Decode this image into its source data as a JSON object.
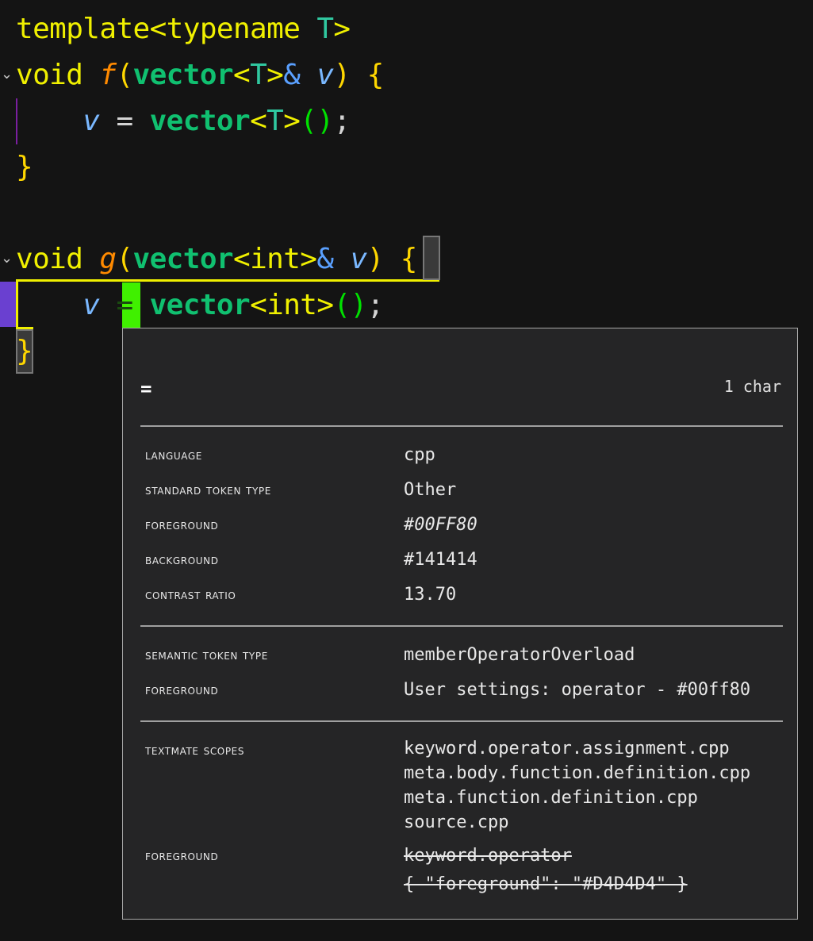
{
  "code": {
    "line1": {
      "template": "template",
      "lt": "<",
      "typename": "typename",
      "T": "T",
      "gt": ">"
    },
    "line2": {
      "void": "void",
      "fname": "f",
      "open": "(",
      "vector": "vector",
      "lt": "<",
      "T": "T",
      "gt": ">",
      "amp": "&",
      "param": "v",
      "close": ")",
      "brace": "{"
    },
    "line3": {
      "v": "v",
      "eq": "=",
      "vector": "vector",
      "lt": "<",
      "T": "T",
      "gt": ">",
      "parens": "()",
      "semi": ";"
    },
    "line4": {
      "brace": "}"
    },
    "line6": {
      "void": "void",
      "fname": "g",
      "open": "(",
      "vector": "vector",
      "lt": "<",
      "int": "int",
      "gt": ">",
      "amp": "&",
      "param": "v",
      "close": ")",
      "brace": "{"
    },
    "line7": {
      "v": "v",
      "eq": "=",
      "vector": "vector",
      "lt": "<",
      "int": "int",
      "gt": ">",
      "parens": "()",
      "semi": ";"
    },
    "line8": {
      "brace": "}"
    }
  },
  "hover": {
    "token": "=",
    "length": "1 char",
    "section1": {
      "language_label": "language",
      "language_value": "cpp",
      "std_token_label": "standard token type",
      "std_token_value": "Other",
      "fg_label": "foreground",
      "fg_value": "#00FF80",
      "bg_label": "background",
      "bg_value": "#141414",
      "contrast_label": "contrast ratio",
      "contrast_value": "13.70"
    },
    "section2": {
      "semantic_label": "semantic token type",
      "semantic_value": "memberOperatorOverload",
      "fg_label": "foreground",
      "fg_value": "User settings: operator - #00ff80"
    },
    "section3": {
      "scopes_label": "textmate scopes",
      "scopes": [
        "keyword.operator.assignment.cpp",
        "meta.body.function.definition.cpp",
        "meta.function.definition.cpp",
        "source.cpp"
      ],
      "fg_label": "foreground",
      "fg_rule": "keyword.operator",
      "fg_rule_value": "{ \"foreground\": \"#D4D4D4\" }"
    }
  },
  "colors": {
    "editor_bg": "#141414",
    "hover_bg": "#252526",
    "accent_operator": "#00FF80"
  }
}
